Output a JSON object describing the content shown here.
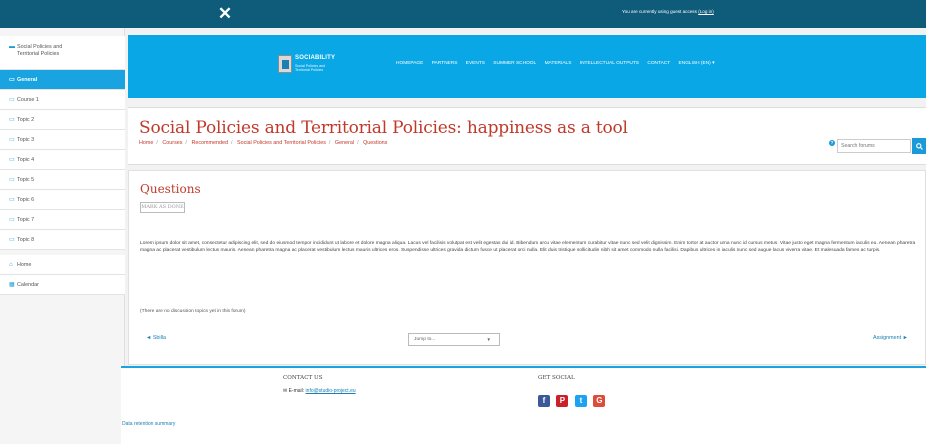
{
  "topbar": {
    "close_glyph": "✕",
    "guest_text": "You are currently using guest access",
    "login_label": "(Log in)"
  },
  "drawer": {
    "course_name_1": "Social Policies and",
    "course_name_2": "Territorial Policies",
    "items": [
      {
        "label": "General",
        "icon": "folder-icon",
        "active": true
      },
      {
        "label": "Course 1",
        "icon": "folder-icon"
      },
      {
        "label": "Topic 2",
        "icon": "folder-icon"
      },
      {
        "label": "Topic 3",
        "icon": "folder-icon"
      },
      {
        "label": "Topic 4",
        "icon": "folder-icon"
      },
      {
        "label": "Topic 5",
        "icon": "folder-icon"
      },
      {
        "label": "Topic 6",
        "icon": "folder-icon"
      },
      {
        "label": "Topic 7",
        "icon": "folder-icon"
      },
      {
        "label": "Topic 8",
        "icon": "folder-icon"
      }
    ],
    "home_label": "Home",
    "calendar_label": "Calendar"
  },
  "header": {
    "logo_word": "SOCIABILITY",
    "logo_tag_1": "Social Policies and",
    "logo_tag_2": "Territorial Policies",
    "nav": [
      "HOMEPAGE",
      "PARTNERS",
      "EVENTS",
      "SUMMER SCHOOL",
      "MATERIALS",
      "INTELLECTUAL OUTPUTS",
      "CONTACT",
      "ENGLISH (EN) ▾"
    ]
  },
  "page": {
    "title": "Social Policies and Territorial Policies: happiness as a tool",
    "breadcrumb": [
      "Home",
      "Courses",
      "Recommended",
      "Social Policies and Territorial Policies",
      "General",
      "Questions"
    ],
    "search_placeholder": "Search forums"
  },
  "forum": {
    "heading": "Questions",
    "mark_done": "MARK AS DONE",
    "description": "Lorem ipsum dolor sit amet, consectetur adipiscing elit, sed do eiusmod tempor incididunt ut labore et dolore magna aliqua. Lacus vel facilisis volutpat est velit egestas dui id. Bibendum arcu vitae elementum curabitur vitae nunc sed velit dignissim. Enim tortor at auctor urna nunc id cursus metus. Vitae justo eget magna fermentum iaculis eu. Aenean pharetra magna ac placerat vestibulum lectus mauris. Aenean pharetra magna ac placerat vestibulum lectus mauris ultrices eros. Suspendisse ultrices gravida dictum fusce ut placerat orci nulla. Elit duis tristique sollicitudin nibh sit amet commodo nulla facilisi. Dapibus ultrices in iaculis nunc sed augue lacus viverra vitae. Et malesuada fames ac turpis.",
    "empty_note": "(There are no discussion topics yet in this forum)",
    "prev_label": "◄ Sbilla",
    "jump_label": "Jump to...",
    "next_label": "Assignment ►"
  },
  "footer": {
    "contact_heading": "CONTACT US",
    "email_label": "E-mail:",
    "email_value": "info@studio-project.eu",
    "social_heading": "GET SOCIAL",
    "data_retention": "Data retention summary"
  },
  "colors": {
    "navbar": "#0f5b7a",
    "header": "#0aa7e6",
    "accent": "#1aa3e1",
    "title": "#c0392b"
  }
}
